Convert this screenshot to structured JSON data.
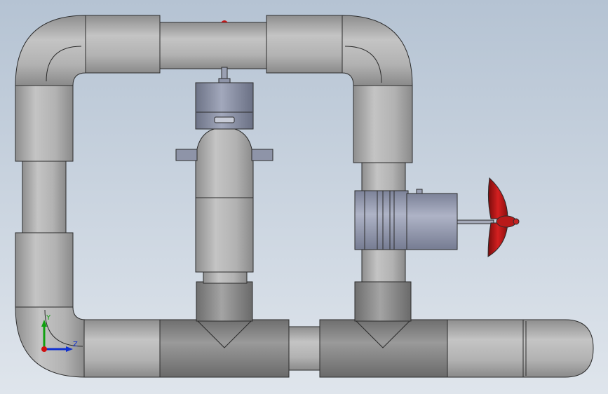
{
  "viewport": {
    "background_top": "#b5c3d3",
    "background_bottom": "#dfe5ec"
  },
  "colors": {
    "pipe_light": "#bdbdbd",
    "pipe_mid": "#a8a8a8",
    "pipe_dark": "#8d8d8d",
    "fitting_dark": "#7a7a7a",
    "outline": "#2c2c2c",
    "valve_body": "#8e94a8",
    "motor_body": "#9aa0b4",
    "propeller_red": "#b01414",
    "axis_x": "#d01010",
    "axis_y": "#10a010",
    "axis_z": "#1030d0"
  },
  "triad": {
    "label_y": "Y",
    "label_z": "Z",
    "icon": "coordinate-triad-icon"
  }
}
